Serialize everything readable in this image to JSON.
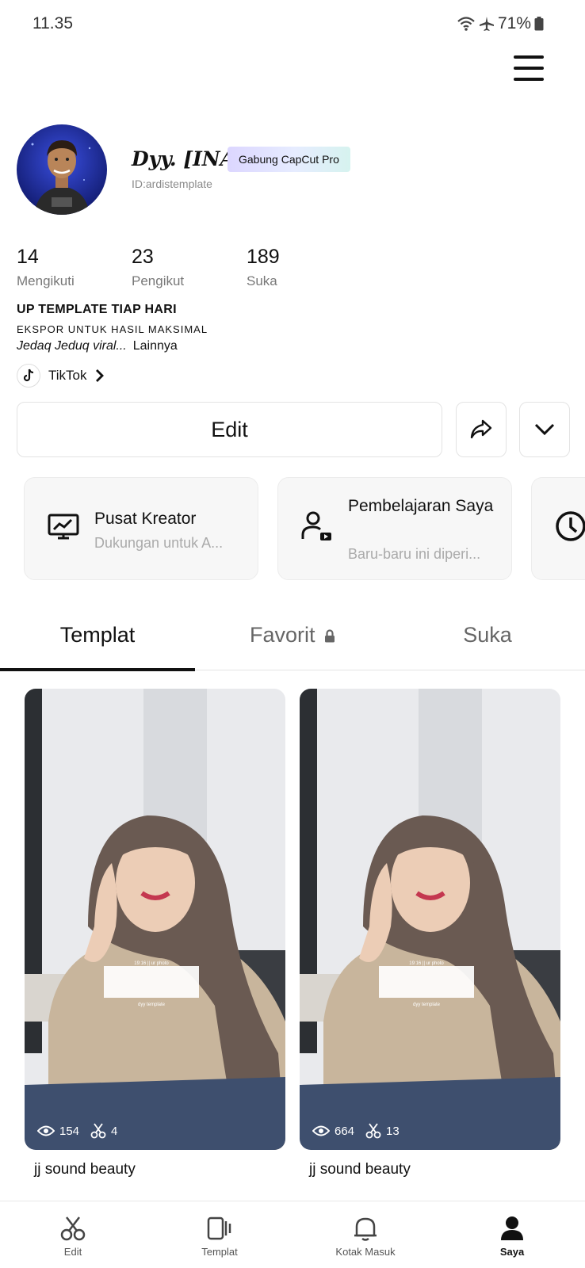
{
  "status_bar": {
    "time": "11.35",
    "battery": "71%"
  },
  "profile": {
    "name": "Dyy. [INA]",
    "pro_badge": "Gabung CapCut Pro",
    "id_text": "ID:ardistemplate",
    "stats": [
      {
        "value": "14",
        "label": "Mengikuti"
      },
      {
        "value": "23",
        "label": "Pengikut"
      },
      {
        "value": "189",
        "label": "Suka"
      }
    ],
    "bio_title": "UP TEMPLATE TIAP HARI",
    "bio_sub": "EKSPOR UNTUK HASIL MAKSIMAL",
    "bio_line": "Jedaq Jeduq viral...",
    "bio_more": "Lainnya",
    "link_label": "TikTok",
    "edit_label": "Edit"
  },
  "cards": [
    {
      "title": "Pusat Kreator",
      "subtitle": "Dukungan untuk A..."
    },
    {
      "title": "Pembelajaran Saya",
      "subtitle": "Baru-baru ini diperi..."
    }
  ],
  "tabs": [
    {
      "label": "Templat"
    },
    {
      "label": "Favorit"
    },
    {
      "label": "Suka"
    }
  ],
  "templates": [
    {
      "title": "jj sound beauty",
      "views": "154",
      "uses": "4",
      "overlay_top": "19:16 || ur photo",
      "overlay_bottom": "dyy template"
    },
    {
      "title": "jj sound beauty",
      "views": "664",
      "uses": "13",
      "overlay_top": "19:16 || ur photo",
      "overlay_bottom": "dyy template"
    }
  ],
  "bottom_nav": [
    {
      "label": "Edit",
      "icon": "scissors-icon"
    },
    {
      "label": "Templat",
      "icon": "template-icon"
    },
    {
      "label": "Kotak Masuk",
      "icon": "bell-icon"
    },
    {
      "label": "Saya",
      "icon": "person-icon"
    }
  ]
}
